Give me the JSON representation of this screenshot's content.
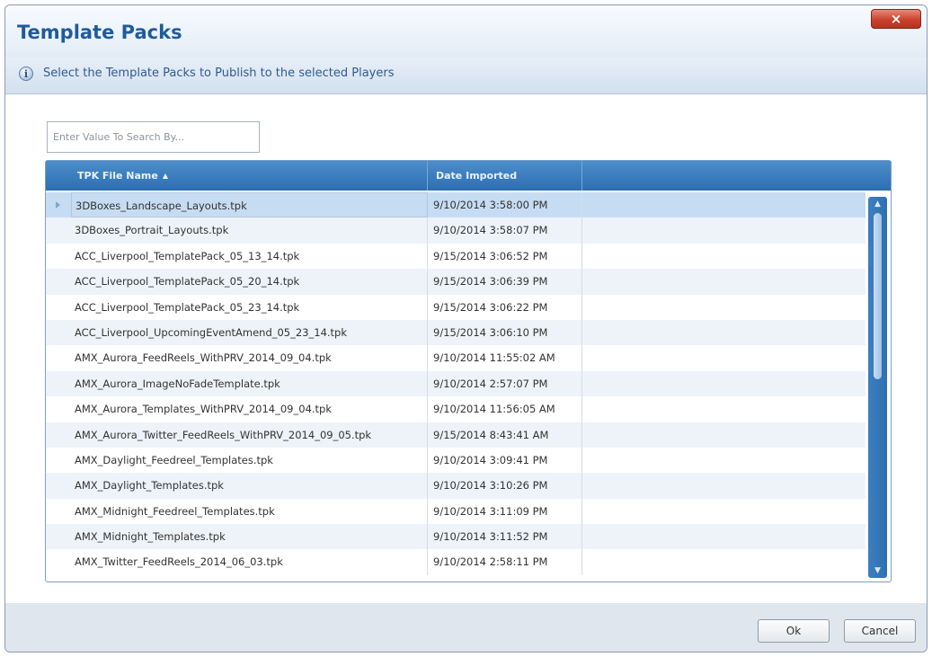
{
  "window": {
    "title": "Template Packs",
    "close_label": "×"
  },
  "info": {
    "icon": "info-icon",
    "text": "Select the Template Packs to Publish to the selected Players"
  },
  "search": {
    "placeholder": "Enter Value To Search By...",
    "value": ""
  },
  "grid": {
    "columns": {
      "name": "TPK File Name",
      "date": "Date Imported",
      "sort_indicator": "▲"
    },
    "selected_row": 0,
    "rows": [
      {
        "name": "3DBoxes_Landscape_Layouts.tpk",
        "date": "9/10/2014 3:58:00 PM"
      },
      {
        "name": "3DBoxes_Portrait_Layouts.tpk",
        "date": "9/10/2014 3:58:07 PM"
      },
      {
        "name": "ACC_Liverpool_TemplatePack_05_13_14.tpk",
        "date": "9/15/2014 3:06:52 PM"
      },
      {
        "name": "ACC_Liverpool_TemplatePack_05_20_14.tpk",
        "date": "9/15/2014 3:06:39 PM"
      },
      {
        "name": "ACC_Liverpool_TemplatePack_05_23_14.tpk",
        "date": "9/15/2014 3:06:22 PM"
      },
      {
        "name": "ACC_Liverpool_UpcomingEventAmend_05_23_14.tpk",
        "date": "9/15/2014 3:06:10 PM"
      },
      {
        "name": "AMX_Aurora_FeedReels_WithPRV_2014_09_04.tpk",
        "date": "9/10/2014 11:55:02 AM"
      },
      {
        "name": "AMX_Aurora_ImageNoFadeTemplate.tpk",
        "date": "9/10/2014 2:57:07 PM"
      },
      {
        "name": "AMX_Aurora_Templates_WithPRV_2014_09_04.tpk",
        "date": "9/10/2014 11:56:05 AM"
      },
      {
        "name": "AMX_Aurora_Twitter_FeedReels_WithPRV_2014_09_05.tpk",
        "date": "9/15/2014 8:43:41 AM"
      },
      {
        "name": "AMX_Daylight_Feedreel_Templates.tpk",
        "date": "9/10/2014 3:09:41 PM"
      },
      {
        "name": "AMX_Daylight_Templates.tpk",
        "date": "9/10/2014 3:10:26 PM"
      },
      {
        "name": "AMX_Midnight_Feedreel_Templates.tpk",
        "date": "9/10/2014 3:11:09 PM"
      },
      {
        "name": "AMX_Midnight_Templates.tpk",
        "date": "9/10/2014 3:11:52 PM"
      },
      {
        "name": "AMX_Twitter_FeedReels_2014_06_03.tpk",
        "date": "9/10/2014 2:58:11 PM"
      }
    ]
  },
  "footer": {
    "ok_label": "Ok",
    "cancel_label": "Cancel"
  },
  "colors": {
    "title": "#1f5b9c",
    "header": "#2c6eb0",
    "selected_row": "#c6dcf2",
    "close_button": "#c9422d"
  }
}
